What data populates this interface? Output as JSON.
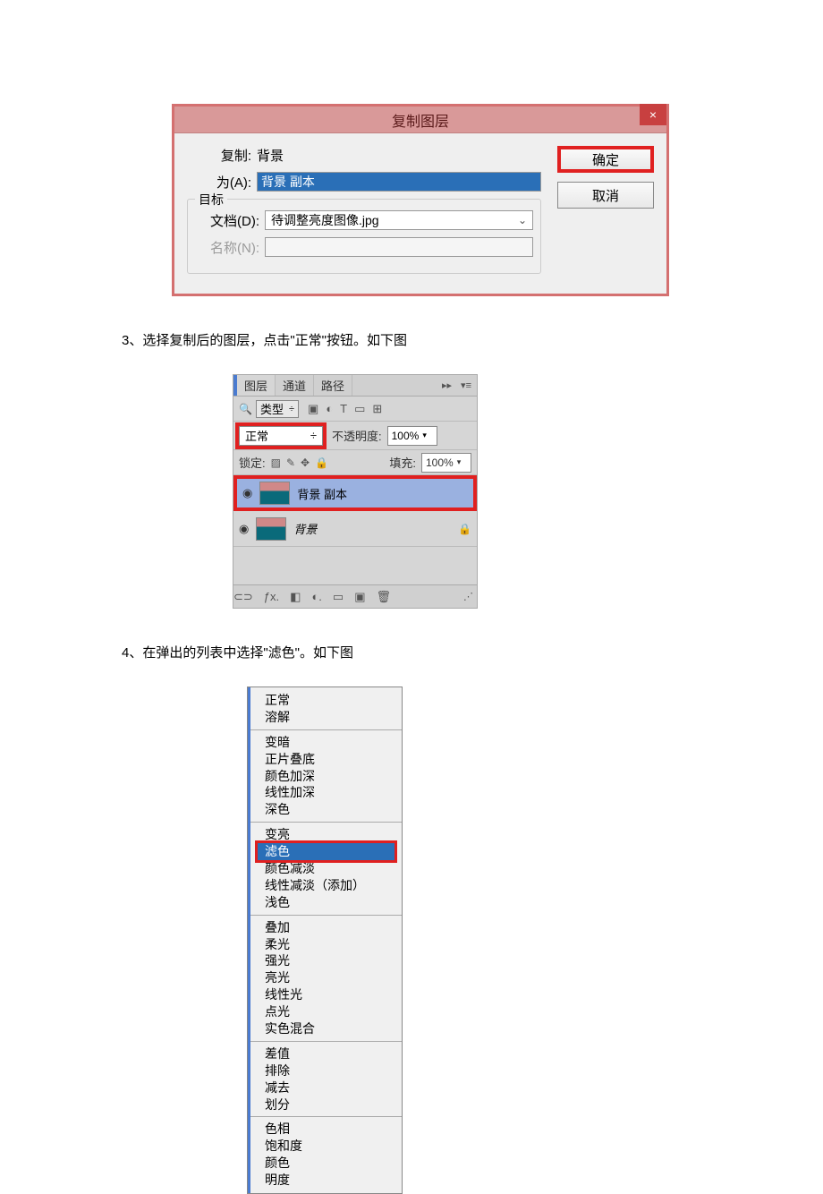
{
  "dialog1": {
    "title": "复制图层",
    "copy_label": "复制:",
    "copy_value": "背景",
    "as_label": "为(A):",
    "as_value": "背景 副本",
    "target_label": "目标",
    "doc_label": "文档(D):",
    "doc_value": "待调整亮度图像.jpg",
    "name_label": "名称(N):",
    "ok": "确定",
    "cancel": "取消",
    "close": "×"
  },
  "step3": "3、选择复制后的图层，点击\"正常\"按钮。如下图",
  "step4": "4、在弹出的列表中选择\"滤色\"。如下图",
  "layers": {
    "tab_layers": "图层",
    "tab_channels": "通道",
    "tab_paths": "路径",
    "collapse": "▸▸",
    "menu": "▾≡",
    "search_icon": "🔍",
    "type_label": "类型",
    "updn": "÷",
    "filter_icons": [
      "▣",
      "◐",
      "T",
      "▭",
      "⊞"
    ],
    "blend_mode": "正常",
    "blend_chev": "÷",
    "opacity_label": "不透明度:",
    "opacity_value": "100%",
    "opacity_arrow": "▾",
    "lock_label": "锁定:",
    "lock_icons": [
      "▨",
      "✎",
      "✥",
      "🔒"
    ],
    "fill_label": "填充:",
    "fill_value": "100%",
    "fill_arrow": "▾",
    "eye": "◉",
    "layer1_name": "背景 副本",
    "layer2_name": "背景",
    "layer2_lock": "🔒",
    "footer_icons": [
      "⊂⊃",
      "ƒx.",
      "◧",
      "◐.",
      "▭",
      "▣",
      "🗑"
    ],
    "grip": "⋰"
  },
  "blend": {
    "group1": [
      "正常",
      "溶解"
    ],
    "group2": [
      "变暗",
      "正片叠底",
      "颜色加深",
      "线性加深",
      "深色"
    ],
    "group3_a": "变亮",
    "group3_sel": "滤色",
    "group3_b": [
      "颜色减淡",
      "线性减淡（添加）",
      "浅色"
    ],
    "group4": [
      "叠加",
      "柔光",
      "强光",
      "亮光",
      "线性光",
      "点光",
      "实色混合"
    ],
    "group5": [
      "差值",
      "排除",
      "减去",
      "划分"
    ],
    "group6": [
      "色相",
      "饱和度",
      "颜色",
      "明度"
    ]
  }
}
